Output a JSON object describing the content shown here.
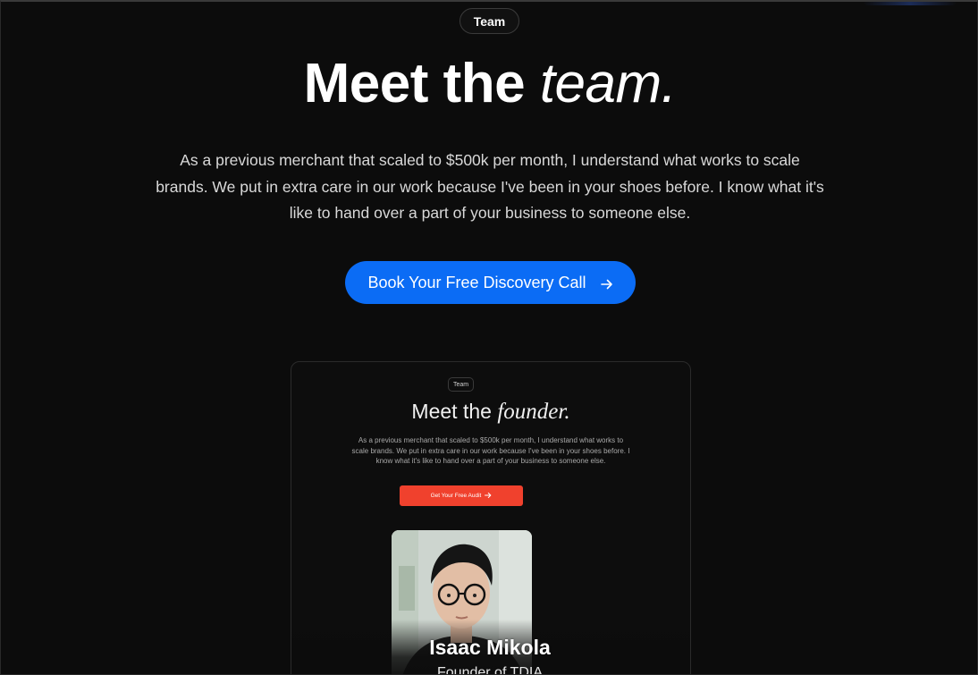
{
  "header": {
    "badge_label": "Team",
    "title_main": "Meet the ",
    "title_italic": "team.",
    "subtitle": "As a previous merchant that scaled to $500k per month, I understand what works to scale brands. We put in extra care in our work because I've been in your shoes before. I know what it's like to hand over a part of your business to someone else.",
    "cta_label": "Book Your Free Discovery Call",
    "cta_icon": "arrow-right-icon"
  },
  "preview": {
    "badge_label": "Team",
    "title_main": "Meet the ",
    "title_italic": "founder.",
    "subtitle": "As a previous merchant that scaled to $500k per month, I understand what works to scale brands. We put in extra care in our work because I've been in your shoes before. I know what it's like to hand over a part of your business to someone else.",
    "cta_label": "Get Your Free Audit",
    "cta_icon": "arrow-right-icon",
    "cta_color": "#f0412d"
  },
  "member": {
    "name": "Isaac Mikola",
    "role": "Founder of TDIA"
  },
  "colors": {
    "background": "#0b0b0b",
    "accent": "#0b6cf5"
  }
}
